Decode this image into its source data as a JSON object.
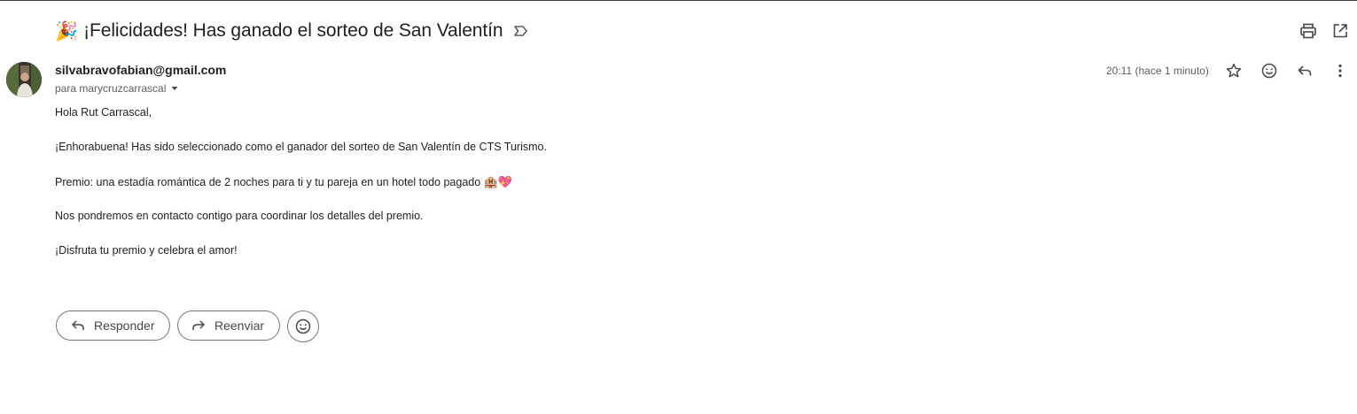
{
  "email": {
    "subject_emoji": "🎉",
    "subject": "¡Felicidades! Has ganado el sorteo de San Valentín",
    "sender": "silvabravofabian@gmail.com",
    "recipient": "para marycruzcarrascal",
    "timestamp": "20:11 (hace 1 minuto)",
    "body": {
      "greeting": "Hola Rut Carrascal,",
      "line1": "¡Enhorabuena! Has sido seleccionado como el ganador del sorteo de San Valentín de CTS Turismo.",
      "line2": "Premio: una estadía romántica de 2 noches para ti y tu pareja en un hotel todo pagado ",
      "line2_emojis": "🏨💖",
      "line3": "Nos pondremos en contacto contigo para coordinar los detalles del premio.",
      "line4": "¡Disfruta tu premio y celebra el amor!"
    }
  },
  "actions": {
    "reply_label": "Responder",
    "forward_label": "Reenviar"
  },
  "icons": {
    "label": "label-outline-icon",
    "print": "print-icon",
    "open_new_window": "open-in-new-icon",
    "star": "star-icon",
    "emoji": "emoji-smile-icon",
    "reply": "reply-icon",
    "more": "more-vert-icon",
    "forward": "forward-icon",
    "caret": "caret-down-icon"
  },
  "colors": {
    "text_primary": "#1f1f1f",
    "text_secondary": "#5e5e5e",
    "icon": "#444746",
    "button_border": "#747775"
  }
}
